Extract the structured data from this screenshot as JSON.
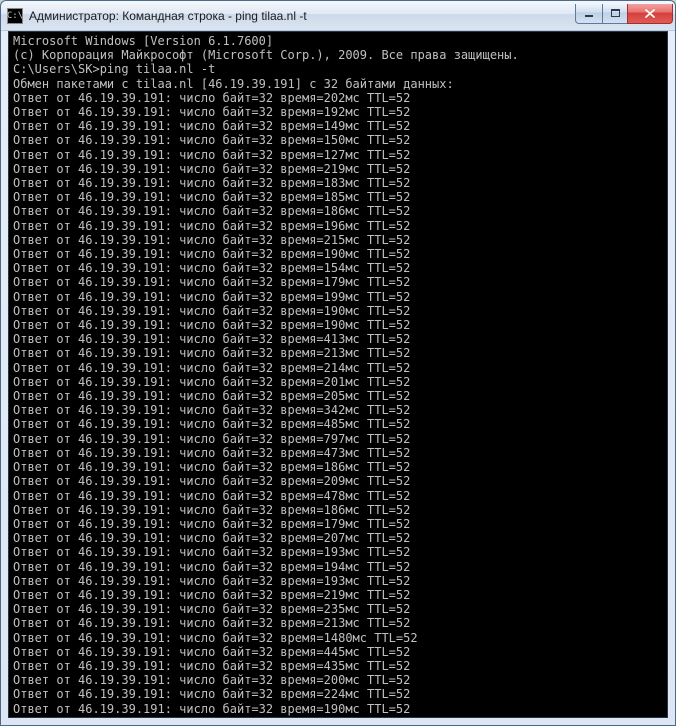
{
  "window": {
    "icon_text": "C:\\",
    "title": "Администратор: Командная строка - ping  tilaa.nl -t"
  },
  "console": {
    "version_line": "Microsoft Windows [Version 6.1.7600]",
    "copyright_line": "(c) Корпорация Майкрософт (Microsoft Corp.), 2009. Все права защищены.",
    "prompt": "C:\\Users\\SK>",
    "command": "ping tilaa.nl -t",
    "exchange_prefix": "Обмен пакетами с ",
    "host": "tilaa.nl",
    "ip": "46.19.39.191",
    "exchange_suffix_a": " с 32 байтами данных:",
    "reply_prefix": "Ответ от ",
    "reply_mid": ": число байт=32 время=",
    "ttl_suffix": " TTL=52",
    "times": [
      "202мс",
      "192мс",
      "149мс",
      "150мс",
      "127мс",
      "219мс",
      "183мс",
      "185мс",
      "186мс",
      "196мс",
      "215мс",
      "190мс",
      "154мс",
      "179мс",
      "199мс",
      "190мс",
      "190мс",
      "413мс",
      "213мс",
      "214мс",
      "201мс",
      "205мс",
      "342мс",
      "485мс",
      "797мс",
      "473мс",
      "186мс",
      "209мс",
      "478мс",
      "186мс",
      "179мс",
      "207мс",
      "193мс",
      "194мс",
      "193мс",
      "219мс",
      "235мс",
      "213мс",
      "1480мс",
      "445мс",
      "435мс",
      "200мс",
      "224мс",
      "190мс"
    ]
  }
}
